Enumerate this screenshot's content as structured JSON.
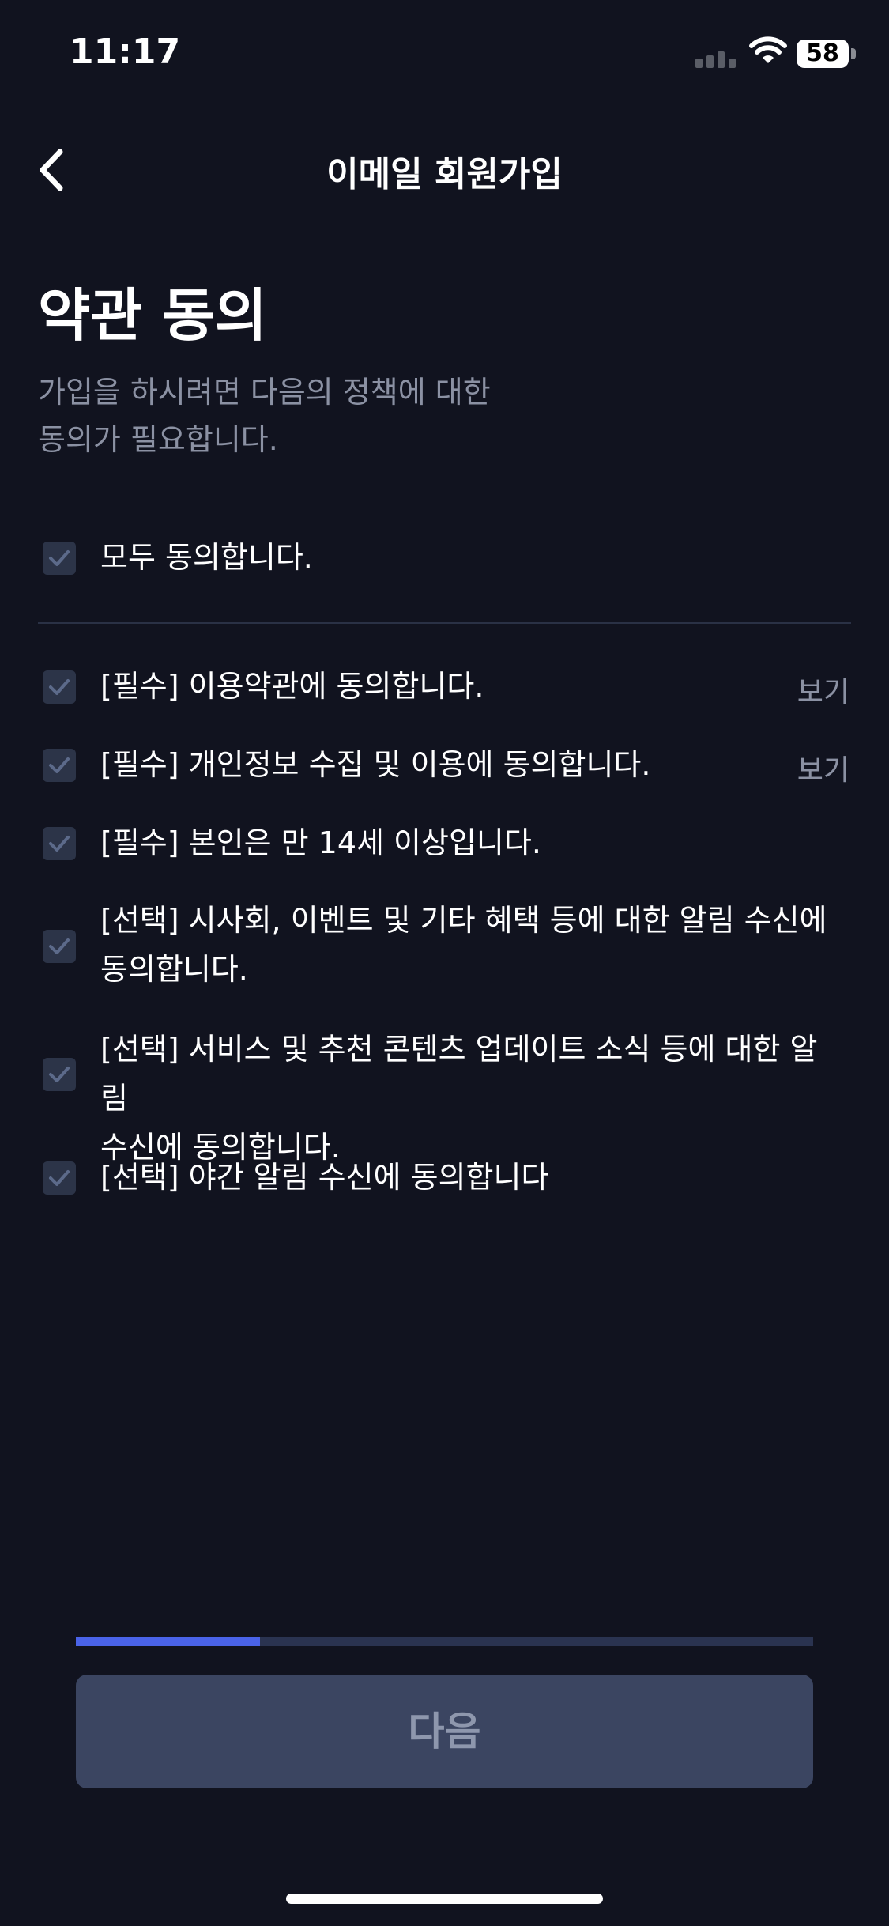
{
  "status_bar": {
    "time": "11:17",
    "battery": "58"
  },
  "nav": {
    "title": "이메일 회원가입"
  },
  "header": {
    "title": "약관 동의",
    "subtitle_line1": "가입을 하시려면 다음의 정책에 대한",
    "subtitle_line2": "동의가 필요합니다."
  },
  "agree_all": {
    "label": "모두 동의합니다.",
    "checked": true
  },
  "terms": [
    {
      "label": "[필수] 이용약관에 동의합니다.",
      "view": "보기",
      "checked": true
    },
    {
      "label": "[필수] 개인정보 수집 및 이용에 동의합니다.",
      "view": "보기",
      "checked": true
    },
    {
      "label": "[필수] 본인은 만 14세 이상입니다.",
      "checked": true
    },
    {
      "label_line1": "[선택] 시사회, 이벤트 및 기타 혜택 등에 대한 알림 수신에",
      "label_line2": "동의합니다.",
      "checked": true
    },
    {
      "label_line1": "[선택] 서비스 및 추천 콘텐츠 업데이트 소식 등에 대한 알림",
      "label_line2": "수신에 동의합니다.",
      "checked": true
    },
    {
      "label": "[선택] 야간 알림 수신에 동의합니다",
      "checked": true
    }
  ],
  "progress": {
    "fraction": 0.25
  },
  "next_button": {
    "label": "다음"
  },
  "colors": {
    "background": "#11131f",
    "accent": "#4a63e8",
    "button_disabled": "#3b4561"
  }
}
